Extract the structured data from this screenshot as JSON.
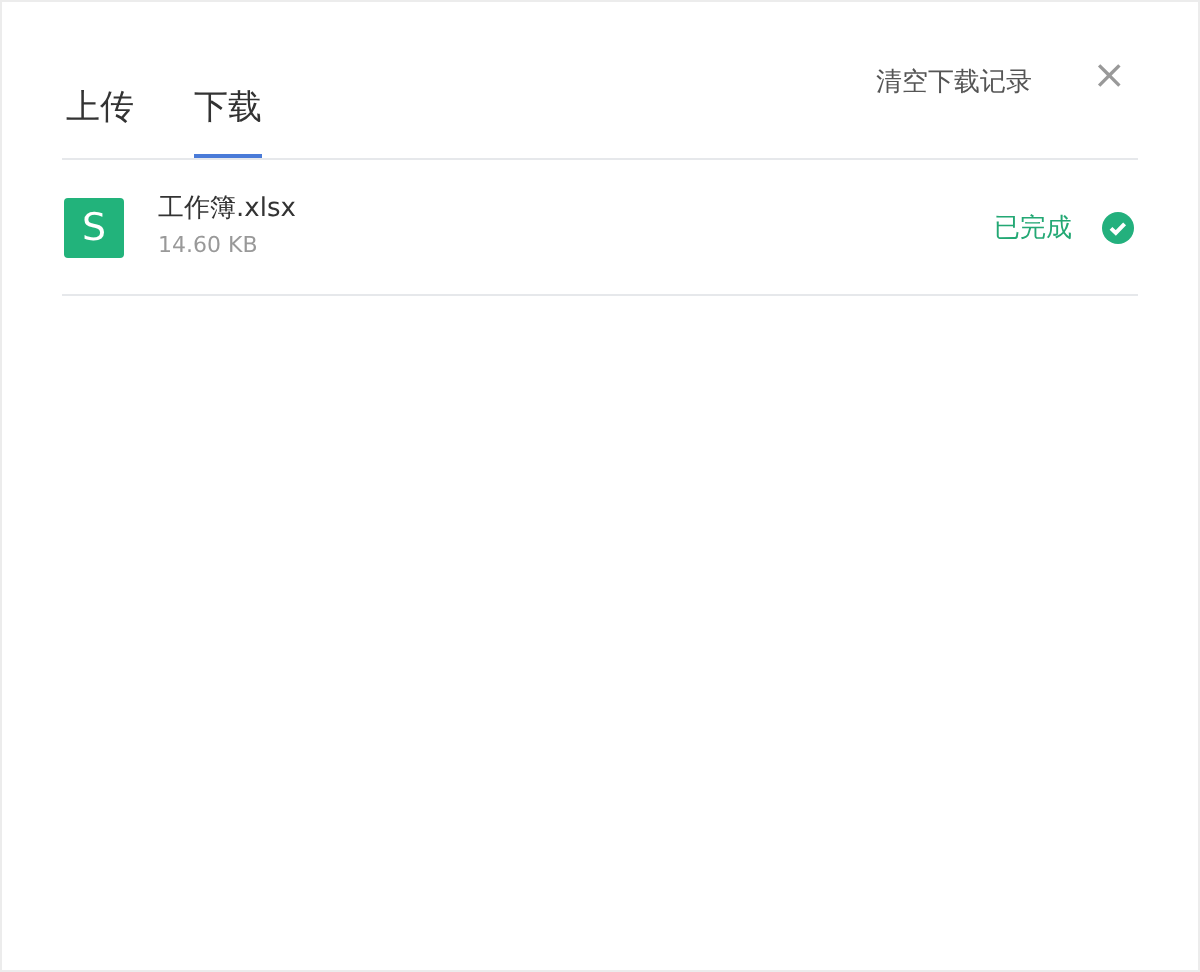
{
  "tabs": [
    {
      "label": "上传",
      "selected": false
    },
    {
      "label": "下载",
      "selected": true
    }
  ],
  "clear_button": "清空下载记录",
  "close_button": "×",
  "files": [
    {
      "icon_letter": "S",
      "name": "工作簿.xlsx",
      "size": "14.60 KB",
      "status": "已完成",
      "completed": true
    }
  ]
}
